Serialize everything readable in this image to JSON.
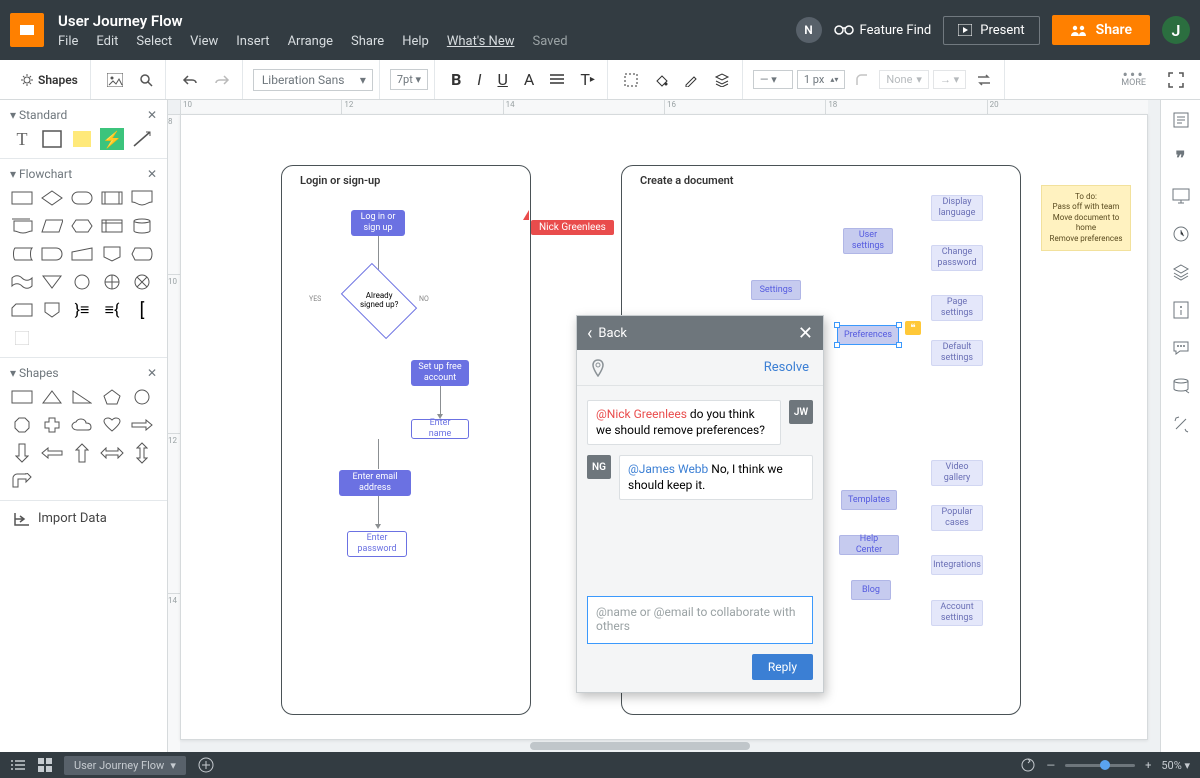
{
  "header": {
    "doc_title": "User Journey Flow",
    "menus": [
      "File",
      "Edit",
      "Select",
      "View",
      "Insert",
      "Arrange",
      "Share",
      "Help",
      "What's New",
      "Saved"
    ],
    "notif_badge": "N",
    "feature_find": "Feature Find",
    "present": "Present",
    "share": "Share",
    "avatar": "J"
  },
  "toolbar": {
    "shapes_label": "Shapes",
    "font": "Liberation Sans",
    "font_size": "7pt",
    "stroke_width": "1 px",
    "fill_label": "None",
    "more_label": "MORE"
  },
  "ruler_h": [
    "10",
    "12",
    "14",
    "16",
    "18",
    "20"
  ],
  "ruler_v": [
    "8",
    "10",
    "12",
    "14"
  ],
  "leftpanel": {
    "sections": {
      "standard": "Standard",
      "flowchart": "Flowchart",
      "shapes": "Shapes"
    },
    "import": "Import Data"
  },
  "canvas": {
    "box1_title": "Login or sign-up",
    "box2_title": "Create a document",
    "nodes": {
      "login": "Log in or\nsign up",
      "already": "Already\nsigned up?",
      "yes": "YES",
      "no": "NO",
      "setup": "Set up free\naccount",
      "entername": "Enter name",
      "enteremail": "Enter email\naddress",
      "enterpass": "Enter\npassword",
      "settings": "Settings",
      "user_settings": "User\nsettings",
      "preferences": "Preferences",
      "templates": "Templates",
      "help_center": "Help Center",
      "blog": "Blog",
      "display_lang": "Display\nlanguage",
      "change_pw": "Change\npassword",
      "page_settings": "Page\nsettings",
      "default_settings": "Default\nsettings",
      "video_gallery": "Video\ngallery",
      "popular_cases": "Popular\ncases",
      "integrations": "Integrations",
      "account_settings": "Account\nsettings"
    },
    "cursor_user": "Nick Greenlees",
    "sticky": "To do:\nPass off with team\nMove document to home\nRemove preferences"
  },
  "comments": {
    "back": "Back",
    "resolve": "Resolve",
    "msgs": [
      {
        "avatar": "JW",
        "mention": "@Nick Greenlees",
        "mention_class": "red",
        "text": " do you think we should remove preferences?"
      },
      {
        "avatar": "NG",
        "mention": "@James Webb",
        "mention_class": "blue",
        "text": " No, I think we should keep it."
      }
    ],
    "placeholder": "@name or @email to collaborate with others",
    "reply": "Reply"
  },
  "bottom": {
    "page": "User Journey Flow",
    "zoom": "50%"
  }
}
